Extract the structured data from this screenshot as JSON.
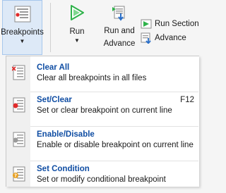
{
  "ribbon": {
    "breakpoints_label": "Breakpoints",
    "run_label": "Run",
    "run_advance_line1": "Run and",
    "run_advance_line2": "Advance",
    "run_section_label": "Run Section",
    "advance_label": "Advance",
    "caret": "▼"
  },
  "menu": {
    "items": [
      {
        "title": "Clear All",
        "description": "Clear all breakpoints in all files",
        "shortcut": "",
        "icon": "clear-all-icon"
      },
      {
        "title": "Set/Clear",
        "description": "Set or clear breakpoint on current line",
        "shortcut": "F12",
        "icon": "set-clear-icon"
      },
      {
        "title": "Enable/Disable",
        "description": "Enable or disable breakpoint on current line",
        "shortcut": "",
        "icon": "enable-disable-icon"
      },
      {
        "title": "Set Condition",
        "description": "Set or modify conditional breakpoint",
        "shortcut": "",
        "icon": "set-condition-icon"
      }
    ]
  },
  "colors": {
    "menu_title": "#0f4da3",
    "run_green": "#2fb24a",
    "breakpoint_red": "#e02b2b",
    "selected_bg": "#dde9f7"
  }
}
